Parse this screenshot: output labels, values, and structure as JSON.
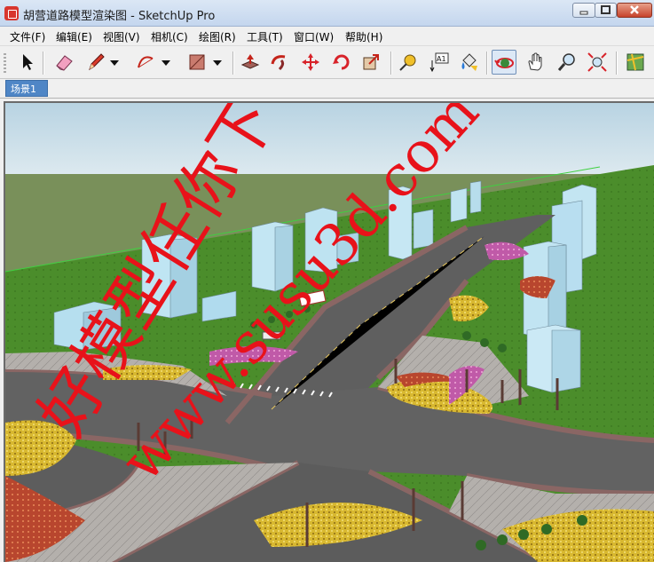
{
  "window": {
    "title": "胡营道路模型渲染图 - SketchUp Pro",
    "minimize_icon": "minimize-icon",
    "maximize_icon": "maximize-icon",
    "close_icon": "close-icon"
  },
  "menu": [
    "文件(F)",
    "编辑(E)",
    "视图(V)",
    "相机(C)",
    "绘图(R)",
    "工具(T)",
    "窗口(W)",
    "帮助(H)"
  ],
  "toolbar": {
    "tools": [
      "select-icon",
      "eraser-icon",
      "pencil-icon",
      "dropdown-icon",
      "arc-icon",
      "dropdown-icon",
      "rectangle-icon",
      "dropdown-icon",
      "push-pull-icon",
      "follow-me-icon",
      "move-icon",
      "rotate-icon",
      "scale-icon",
      "tape-measure-icon",
      "text-icon",
      "paint-bucket-icon",
      "orbit-icon",
      "pan-icon",
      "zoom-icon",
      "zoom-extents-icon",
      "map-icon"
    ],
    "active_tool": "orbit-icon"
  },
  "scenes": {
    "tab": "场景1"
  },
  "watermark": {
    "line1": "好模型任你下",
    "line2": "www.susu3d.com",
    "color": "#e8121a"
  },
  "viewport": {
    "sky_color": "#c9dee8",
    "ground_color": "#4a8a2a",
    "road_color": "#5f5f5f"
  }
}
